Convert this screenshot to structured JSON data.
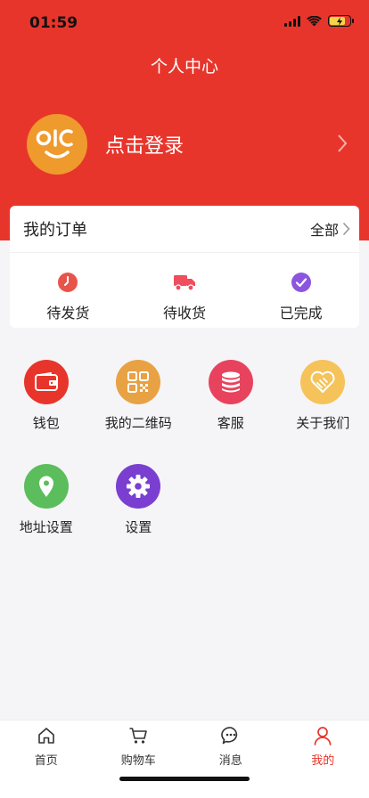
{
  "status_bar": {
    "time": "01:59"
  },
  "header": {
    "title": "个人中心"
  },
  "profile": {
    "login_label": "点击登录"
  },
  "orders": {
    "title": "我的订单",
    "all_label": "全部",
    "items": [
      {
        "label": "待发货",
        "icon": "clock-icon",
        "color": "#e8544a"
      },
      {
        "label": "待收货",
        "icon": "truck-icon",
        "color": "#ee4e5e"
      },
      {
        "label": "已完成",
        "icon": "check-circle-icon",
        "color": "#8b55e0"
      }
    ]
  },
  "menu": {
    "items": [
      {
        "label": "钱包",
        "icon": "wallet-icon",
        "color": "#e8352b"
      },
      {
        "label": "我的二维码",
        "icon": "qr-code-icon",
        "color": "#e8a244"
      },
      {
        "label": "客服",
        "icon": "database-icon",
        "color": "#e8435e"
      },
      {
        "label": "关于我们",
        "icon": "heart-icon",
        "color": "#f5c35a"
      },
      {
        "label": "地址设置",
        "icon": "location-pin-icon",
        "color": "#5cbd5c"
      },
      {
        "label": "设置",
        "icon": "gear-icon",
        "color": "#7a3fd0"
      }
    ]
  },
  "tabbar": {
    "items": [
      {
        "label": "首页",
        "icon": "home-icon"
      },
      {
        "label": "购物车",
        "icon": "cart-icon"
      },
      {
        "label": "消息",
        "icon": "message-icon"
      },
      {
        "label": "我的",
        "icon": "user-icon",
        "active": true
      }
    ],
    "active_color": "#e8352b"
  },
  "colors": {
    "brand": "#e8352b",
    "background": "#f5f5f7"
  }
}
